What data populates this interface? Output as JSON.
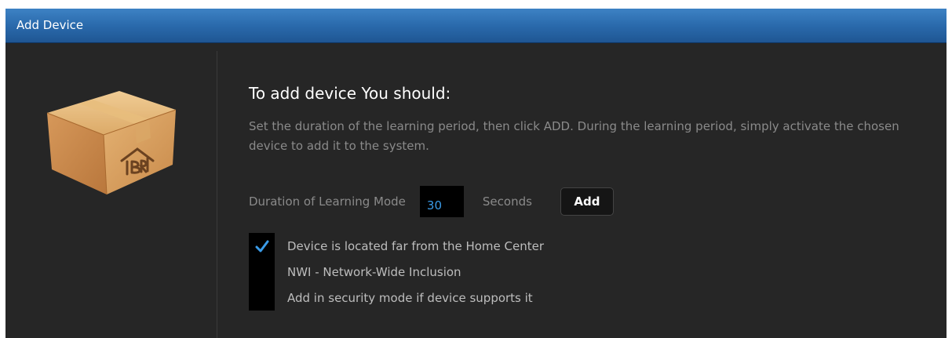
{
  "dialog": {
    "title": "Add Device"
  },
  "instructions": {
    "heading": "To add device You should:",
    "description": "Set the duration of the learning period, then click ADD. During the learning period, simply activate the chosen device to add it to the system."
  },
  "duration": {
    "label": "Duration of Learning Mode",
    "value": "30",
    "unit": "Seconds",
    "add_label": "Add"
  },
  "options": [
    {
      "label": "Device is located far from the Home Center",
      "checked": true
    },
    {
      "label": "NWI - Network-Wide Inclusion",
      "checked": false
    },
    {
      "label": "Add in security mode if device supports it",
      "checked": false
    }
  ],
  "colors": {
    "header_blue": "#2a6aac",
    "panel_bg": "#262626",
    "accent_blue": "#3a9be8",
    "box_tan": "#d9a15c"
  },
  "icons": {
    "device_box": "package-box-icon",
    "check": "checkmark-icon"
  }
}
